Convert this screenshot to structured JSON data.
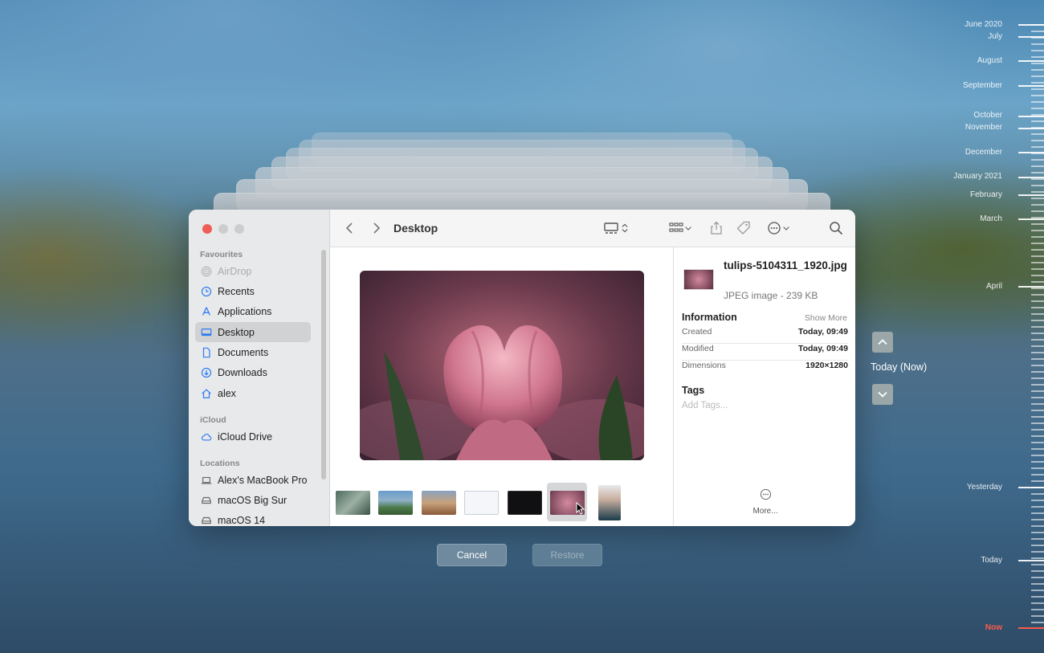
{
  "window": {
    "title": "Desktop"
  },
  "sidebar": {
    "sections": {
      "favourites": "Favourites",
      "icloud": "iCloud",
      "locations": "Locations"
    },
    "items": [
      {
        "label": "AirDrop",
        "icon": "airdrop-icon"
      },
      {
        "label": "Recents",
        "icon": "clock-icon"
      },
      {
        "label": "Applications",
        "icon": "applications-icon"
      },
      {
        "label": "Desktop",
        "icon": "desktop-icon"
      },
      {
        "label": "Documents",
        "icon": "document-icon"
      },
      {
        "label": "Downloads",
        "icon": "download-icon"
      },
      {
        "label": "alex",
        "icon": "home-icon"
      },
      {
        "label": "iCloud Drive",
        "icon": "cloud-icon"
      },
      {
        "label": "Alex's MacBook Pro",
        "icon": "laptop-icon"
      },
      {
        "label": "macOS Big Sur",
        "icon": "disk-icon"
      },
      {
        "label": "macOS 14",
        "icon": "disk-icon"
      }
    ],
    "active_item": "Desktop"
  },
  "info": {
    "filename": "tulips-5104311_1920.jpg",
    "filetype": "JPEG image - 239 KB",
    "information_header": "Information",
    "show_more": "Show More",
    "rows": [
      {
        "key": "Created",
        "value": "Today, 09:49"
      },
      {
        "key": "Modified",
        "value": "Today, 09:49"
      },
      {
        "key": "Dimensions",
        "value": "1920×1280"
      }
    ],
    "tags_header": "Tags",
    "add_tags_placeholder": "Add Tags...",
    "more_label": "More..."
  },
  "buttons": {
    "cancel": "Cancel",
    "restore": "Restore"
  },
  "time_machine": {
    "current_label": "Today (Now)",
    "timeline": [
      "June 2020",
      "July",
      "August",
      "September",
      "October",
      "November",
      "December",
      "January 2021",
      "February",
      "March",
      "April",
      "Yesterday",
      "Today",
      "Now"
    ]
  },
  "colors": {
    "close_button": "#ee5e57",
    "now_marker": "#ff5a4a",
    "cancel_button": "#6f8a9e"
  }
}
